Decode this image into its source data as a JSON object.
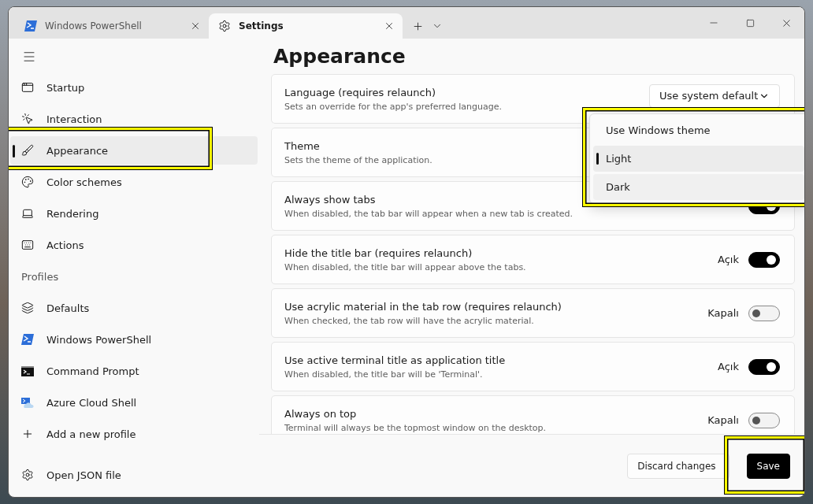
{
  "tabs": [
    {
      "label": "Windows PowerShell",
      "selected": false
    },
    {
      "label": "Settings",
      "selected": true
    }
  ],
  "sidebar": {
    "items": [
      {
        "kind": "nav",
        "label": "Startup",
        "selected": false
      },
      {
        "kind": "nav",
        "label": "Interaction",
        "selected": false
      },
      {
        "kind": "nav",
        "label": "Appearance",
        "selected": true
      },
      {
        "kind": "nav",
        "label": "Color schemes",
        "selected": false
      },
      {
        "kind": "nav",
        "label": "Rendering",
        "selected": false
      },
      {
        "kind": "nav",
        "label": "Actions",
        "selected": false
      },
      {
        "kind": "header",
        "label": "Profiles"
      },
      {
        "kind": "nav",
        "label": "Defaults",
        "selected": false
      },
      {
        "kind": "nav",
        "label": "Windows PowerShell",
        "selected": false
      },
      {
        "kind": "nav",
        "label": "Command Prompt",
        "selected": false
      },
      {
        "kind": "nav",
        "label": "Azure Cloud Shell",
        "selected": false
      },
      {
        "kind": "nav",
        "label": "Add a new profile",
        "selected": false
      }
    ],
    "footer_item": {
      "label": "Open JSON file"
    }
  },
  "page_title": "Appearance",
  "settings": [
    {
      "kind": "dropdown",
      "title": "Language (requires relaunch)",
      "description": "Sets an override for the app's preferred language.",
      "value": "Use system default"
    },
    {
      "kind": "plain",
      "title": "Theme",
      "description": "Sets the theme of the application."
    },
    {
      "kind": "toggle",
      "title": "Always show tabs",
      "description": "When disabled, the tab bar will appear when a new tab is created.",
      "on": true
    },
    {
      "kind": "toggle",
      "title": "Hide the title bar (requires relaunch)",
      "description": "When disabled, the title bar will appear above the tabs.",
      "on": true,
      "state_label": "Açık"
    },
    {
      "kind": "toggle",
      "title": "Use acrylic material in the tab row (requires relaunch)",
      "description": "When checked, the tab row will have the acrylic material.",
      "on": false,
      "state_label": "Kapalı"
    },
    {
      "kind": "toggle",
      "title": "Use active terminal title as application title",
      "description": "When disabled, the title bar will be 'Terminal'.",
      "on": true,
      "state_label": "Açık"
    },
    {
      "kind": "toggle",
      "title": "Always on top",
      "description": "Terminal will always be the topmost window on the desktop.",
      "on": false,
      "state_label": "Kapalı"
    }
  ],
  "theme_menu": {
    "options": [
      {
        "label": "Use Windows theme",
        "selected": false
      },
      {
        "label": "Light",
        "selected": true
      },
      {
        "label": "Dark",
        "selected": false
      }
    ]
  },
  "footer": {
    "buttons": [
      {
        "label": "Discard changes",
        "kind": "secondary"
      },
      {
        "label": "Save",
        "kind": "primary"
      }
    ]
  }
}
